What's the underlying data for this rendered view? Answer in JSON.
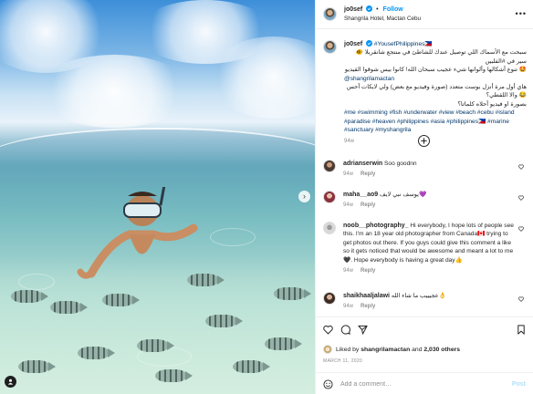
{
  "header": {
    "username": "jo0sef",
    "follow_label": "Follow",
    "separator": "•",
    "location": "Shangrila Hotel, Mactan Cebu",
    "more_label": "•••"
  },
  "caption": {
    "username": "jo0sef",
    "line1_tag": "#YousefPhilippines🇵🇭",
    "arabic1": "سبحت مع الأسماك اللي توصيل عندك للشاطئ في منتجع شانقريلا 🐠 سير في #الفلبين",
    "arabic2": "🤩 تنوع أشكالها وألوانها شيء عجيب سبحان الله! كانوا بيس شوقوا القيديو",
    "mention": "@shangrilamactan",
    "arabic3": "هاي أول مرة أنزل بوست متعدد (صورة وفيديو مع بعض) ولي لايكات أحس 😂 والا اللقطي؟",
    "arabic4": "بصورة او فيديو أحلاه كلماتا؟",
    "hashtags": "#me #swimming #fish #underwater #view #beach #cebu #island #paradise #heaven #philippines #asia #philippines🇵🇭 #marine #sanctuary #myshangrila",
    "time": "94w"
  },
  "comments": [
    {
      "username": "adrianserwin",
      "text": "Soo goodnn",
      "time": "94w",
      "reply": "Reply"
    },
    {
      "username": "maha__ao9",
      "text": "يوسف نبي لايف💜",
      "time": "94w",
      "reply": "Reply"
    },
    {
      "username": "noob__photography_",
      "text": "Hi everybody, I hope lots of people see this. I'm an 18 year old photographer from Canada🇨🇦 trying to get photos out there. If you guys could give this comment a like so it gets noticed that would be awesome and meant a lot to me🖤. Hope everybody is having a great day👍",
      "time": "94w",
      "reply": "Reply"
    },
    {
      "username": "shaikhaaljalawi",
      "text": "عجيييب ما شاء الله👌",
      "time": "94w",
      "reply": "Reply"
    }
  ],
  "likes": {
    "prefix": "Liked by",
    "user": "shangrilamactan",
    "middle": "and",
    "count": "2,030 others"
  },
  "date": "MARCH 11, 2020",
  "add_comment": {
    "placeholder": "Add a comment…",
    "post_label": "Post"
  },
  "photo": {
    "next_arrow": "›"
  },
  "icons": {
    "verified": "verified-badge-icon",
    "heart": "heart-icon",
    "comment": "comment-icon",
    "share": "share-icon",
    "bookmark": "bookmark-icon",
    "emoji": "emoji-icon",
    "plus": "plus-circle-icon",
    "user_tag": "user-tag-icon"
  },
  "colors": {
    "accent": "#0095f6",
    "link": "#00376b",
    "muted": "#8e8e8e"
  }
}
